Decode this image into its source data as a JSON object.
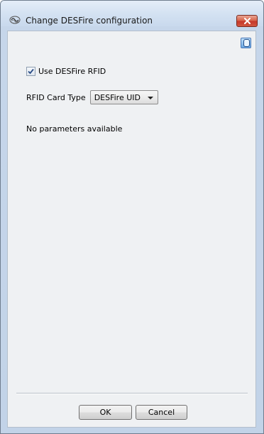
{
  "window": {
    "title": "Change DESFire configuration",
    "title_icon": "wave-logo-icon",
    "close_icon": "close-icon"
  },
  "help": {
    "icon": "help-icon"
  },
  "use_rfid": {
    "label": "Use DESFire RFID",
    "checked": true
  },
  "card_type": {
    "label": "RFID Card Type",
    "selected": "DESFire UID"
  },
  "params": {
    "message": "No parameters available"
  },
  "buttons": {
    "ok": "OK",
    "cancel": "Cancel"
  },
  "colors": {
    "close_button": "#c5382a",
    "client_background": "#eff1f3",
    "frame_background": "#c2d3e8"
  }
}
